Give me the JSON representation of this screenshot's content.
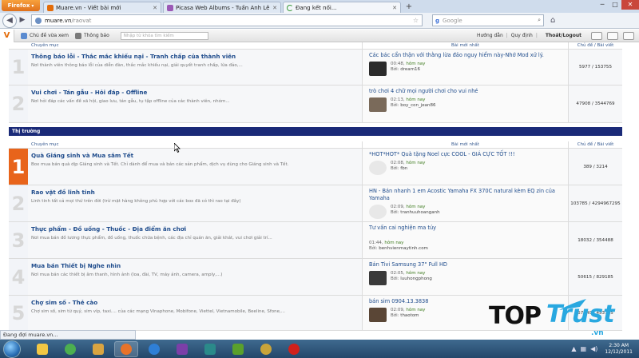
{
  "browser": {
    "menu_button": "Firefox",
    "tabs": [
      {
        "title": "Muare.vn - Viết bài mới",
        "active": false,
        "favicon_color": "#e36c0a"
      },
      {
        "title": "Picasa Web Albums - Tuấn Anh Lê",
        "active": false,
        "favicon_color": "#9b59b6"
      },
      {
        "title": "Đang kết nối...",
        "active": true,
        "favicon_color": "#3a9a3a"
      }
    ],
    "new_tab_symbol": "+",
    "window_controls": {
      "minimize": "─",
      "maximize": "□",
      "close": "✕"
    },
    "url_host": "muare.vn",
    "url_path": "/raovat",
    "search_engine": "Google",
    "search_placeholder": "Google",
    "status_text": "Đang đợi muare.vn..."
  },
  "forum_bar": {
    "logo": "V",
    "items": [
      "Chủ đề vừa xem",
      "Thông báo"
    ],
    "search_placeholder": "Nhập từ khóa tìm kiếm",
    "links": [
      "Hướng dẫn",
      "Quy định"
    ],
    "logout": "Thoát/Logout"
  },
  "table_header": {
    "forum": "Chuyên mục",
    "last_post": "Bài mới nhất",
    "stats": "Chủ đề / Bài viết"
  },
  "top_rows": [
    {
      "number": "1",
      "title": "Thông báo lỗi - Thắc mắc khiếu nại - Tranh chấp của thành viên",
      "desc": "Nơi thành viên thông báo lỗi của diễn đàn, thắc mắc khiếu nại, giải quyết tranh chấp, lừa đảo,...",
      "last_title": "Các bác cẩn thận với thằng lừa đảo nguy hiểm này-Nhớ Mod xử lý.",
      "time": "00:48,",
      "today": "hôm nay",
      "by_label": "Bởi:",
      "by": "dream16",
      "avatar": "#2b2b2b",
      "stats": "5977 / 153755"
    },
    {
      "number": "2",
      "title": "Vui chơi - Tán gẫu - Hỏi đáp - Offline",
      "desc": "Nơi hỏi đáp các vấn đề xã hội, giao lưu, tán gẫu, tụ tập offline của các thành viên, nhóm...",
      "last_title": "trò chơi 4 chữ mọi người chơi cho vui nhé",
      "time": "02:13,",
      "today": "hôm nay",
      "by_label": "Bởi:",
      "by": "boy_con_jean86",
      "avatar": "#7a6a5a",
      "stats": "47908 / 3544769"
    }
  ],
  "section_title": "Thị trường",
  "market_rows": [
    {
      "number": "1",
      "hot": true,
      "title": "Quà Giáng sinh và Mua sắm Tết",
      "desc": "Box mua bán quà dịp Giáng sinh và Tết. Chỉ dành để mua và bán các sản phẩm, dịch vụ dùng cho Giáng sinh và Tết.",
      "last_title": "*HOT*HOT* Quà tặng Noel cực COOL - GIÁ CỰC TỐT !!!",
      "time": "02:08,",
      "today": "hôm nay",
      "by_label": "Bởi:",
      "by": "fbn",
      "avatar": "#e8e8e8",
      "stats": "389 / 3214"
    },
    {
      "number": "2",
      "hot": false,
      "title": "Rao vặt đồ linh tinh",
      "desc": "Linh tinh tất cả mọi thứ trên đời (trừ mặt hàng không phù hợp với các box đã có thì rao tại đây)",
      "last_title": "HN - Bán nhanh 1 em Acostic Yamaha FX 370C natural kèm EQ zin của Yamaha",
      "time": "02:09,",
      "today": "hôm nay",
      "by_label": "Bởi:",
      "by": "tranhuuhoanganh",
      "avatar": "#e8e8e8",
      "stats": "103785 / 4294967295"
    },
    {
      "number": "3",
      "hot": false,
      "title": "Thực phẩm - Đồ uống - Thuốc - Địa điểm ăn chơi",
      "desc": "Nơi mua bán đồ lương thực phẩm, đồ uống, thuốc chữa bệnh, các địa chỉ quán ăn, giải khát, vui chơi giải trí...",
      "last_title": "Tư vấn cai nghiện ma túy",
      "time": "01:44,",
      "today": "hôm nay",
      "by_label": "Bởi:",
      "by": "benhvienmaytinh.com",
      "avatar": "",
      "stats": "18032 / 354488"
    },
    {
      "number": "4",
      "hot": false,
      "title": "Mua bán Thiết bị Nghe nhìn",
      "desc": "Nơi mua bán các thiết bị âm thanh, hình ảnh (loa, đài, TV, máy ảnh, camera, amply,...)",
      "last_title": "Bán Tivi Samsung 37\" Full HD",
      "time": "02:05,",
      "today": "hôm nay",
      "by_label": "Bởi:",
      "by": "luuhongphong",
      "avatar": "#3a3a3a",
      "stats": "50615 / 829185"
    },
    {
      "number": "5",
      "hot": false,
      "title": "Chợ sim số - Thẻ cào",
      "desc": "Chợ sim số, sim từ quý, sim víp, taxi.... của các mạng Vinaphone, Mobifone, Viettel, Vietnamobile, Beeline, Sfone,...",
      "last_title": "bán sim 0904.13.3838",
      "time": "02:09,",
      "today": "hôm nay",
      "by_label": "Bởi:",
      "by": "thaotom",
      "avatar": "#5a4636",
      "stats": "57540 / 453785"
    }
  ],
  "taskbar": {
    "apps": [
      {
        "name": "explorer",
        "color": "#f2c744",
        "open": false
      },
      {
        "name": "chrome",
        "color": "#4caf50",
        "open": false
      },
      {
        "name": "winamp",
        "color": "#d9a441",
        "open": false
      },
      {
        "name": "firefox",
        "color": "#e8732a",
        "open": true
      },
      {
        "name": "ie",
        "color": "#2f7fd6",
        "open": false
      },
      {
        "name": "yahoo",
        "color": "#7b3fa8",
        "open": false
      },
      {
        "name": "notes",
        "color": "#2b8a8a",
        "open": false
      },
      {
        "name": "utorrent",
        "color": "#5aa02c",
        "open": false
      },
      {
        "name": "paint",
        "color": "#c9a43a",
        "open": false
      },
      {
        "name": "record",
        "color": "#d0201b",
        "open": false
      }
    ],
    "time": "2:30 AM",
    "date": "12/12/2011"
  },
  "watermark": {
    "top": "TOP",
    "trust": "Trust",
    "domain": ".vn"
  }
}
